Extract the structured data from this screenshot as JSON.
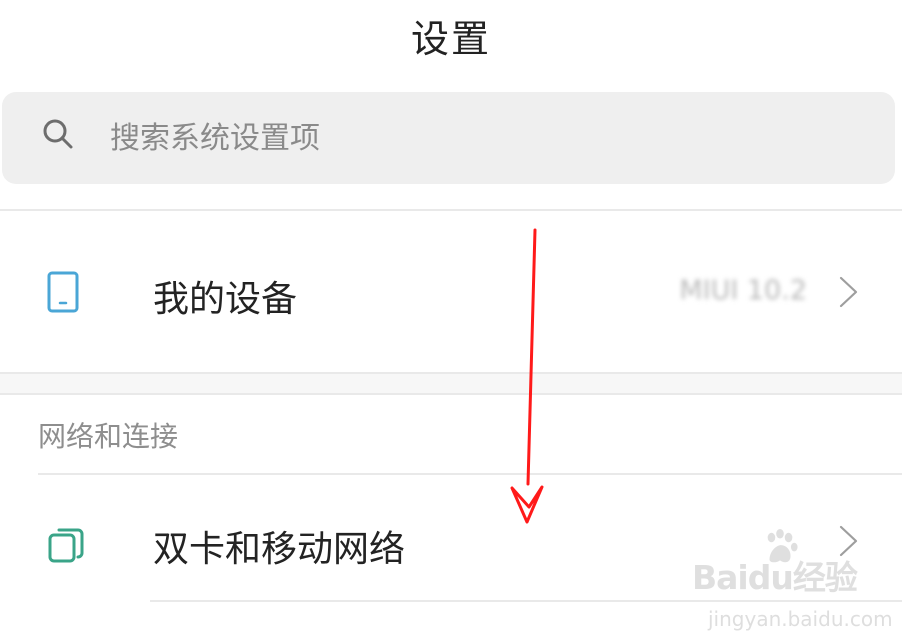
{
  "header": {
    "title": "设置"
  },
  "search": {
    "placeholder": "搜索系统设置项",
    "value": ""
  },
  "device": {
    "label": "我的设备",
    "value": "MIUI 10.2"
  },
  "network_section": {
    "header": "网络和连接",
    "items": [
      {
        "label": "双卡和移动网络",
        "icon": "sim-cards-icon"
      }
    ]
  },
  "watermark": {
    "brand": "Baidu经验",
    "url": "jingyan.baidu.com"
  },
  "colors": {
    "icon_blue": "#4aa6d6",
    "icon_teal": "#3aa488",
    "annotation_red": "#ff1a1a",
    "background": "#ffffff",
    "search_bg": "#efefef"
  }
}
